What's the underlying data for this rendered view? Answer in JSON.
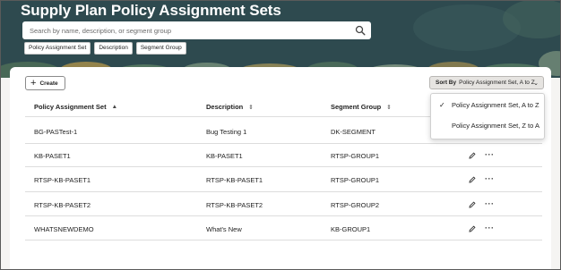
{
  "page": {
    "title": "Supply Plan Policy Assignment Sets"
  },
  "search": {
    "placeholder": "Search by name, description, or segment group",
    "icon": "search-icon"
  },
  "filters": [
    "Policy Assignment Set",
    "Description",
    "Segment Group"
  ],
  "toolbar": {
    "create_label": "Create",
    "sort_prefix": "Sort By",
    "sort_value": "Policy Assignment Set, A to Z"
  },
  "table": {
    "columns": [
      "Policy Assignment Set",
      "Description",
      "Segment Group"
    ],
    "rows": [
      [
        "BG-PASTest-1",
        "Bug Testing 1",
        "DK-SEGMENT"
      ],
      [
        "KB-PASET1",
        "KB-PASET1",
        "RTSP-GROUP1"
      ],
      [
        "RTSP-KB-PASET1",
        "RTSP-KB-PASET1",
        "RTSP-GROUP1"
      ],
      [
        "RTSP-KB-PASET2",
        "RTSP-KB-PASET2",
        "RTSP-GROUP2"
      ],
      [
        "WHATSNEWDEMO",
        "What's New",
        "KB-GROUP1"
      ]
    ]
  },
  "sort_menu": {
    "options": [
      "Policy Assignment Set, A to Z",
      "Policy Assignment Set, Z to A"
    ],
    "selected_index": 0
  },
  "colors": {
    "header_bg": "#2e4a4f",
    "accent": "#3d6a6f"
  }
}
